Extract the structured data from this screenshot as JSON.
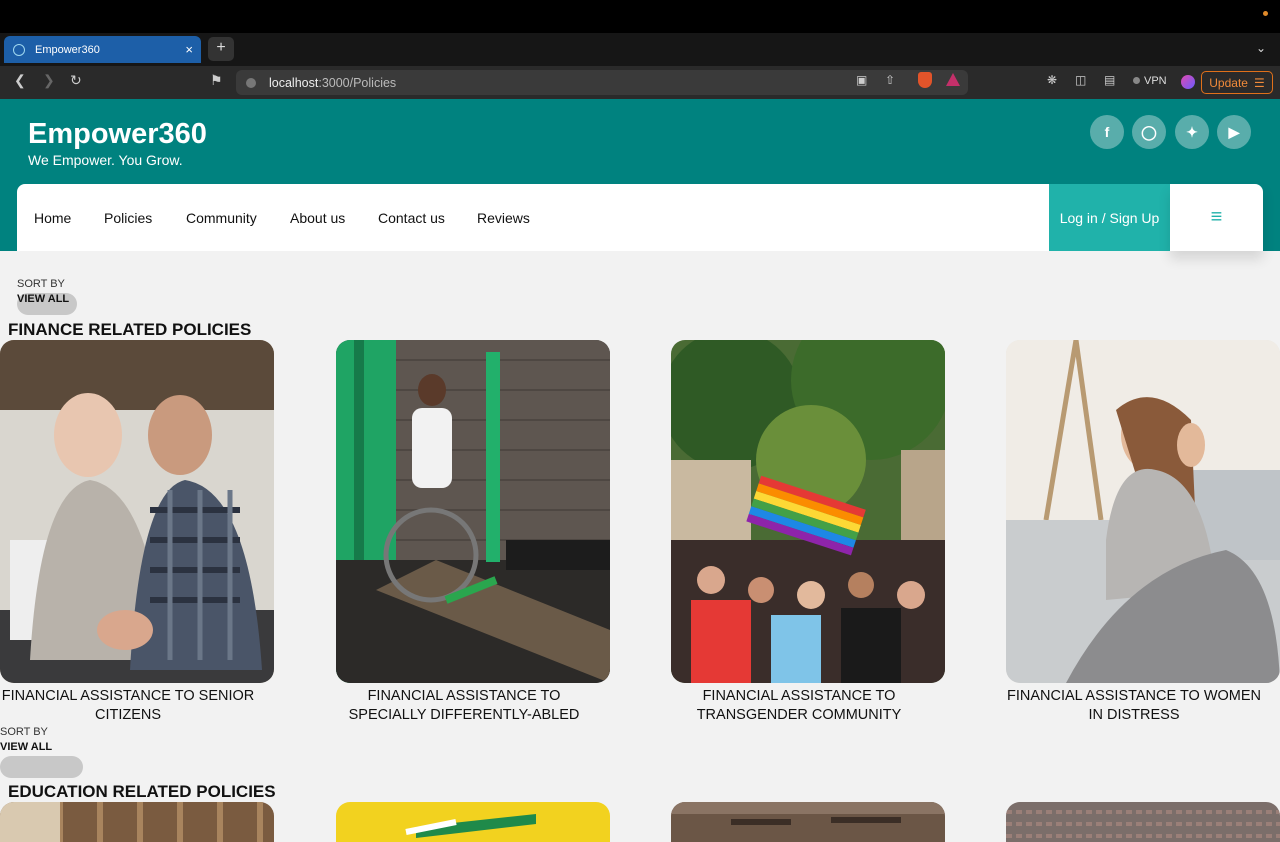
{
  "browser": {
    "tab_title": "Empower360",
    "tab_close": "×",
    "new_tab": "+",
    "tab_chevron": "⌄",
    "url_host": "localhost",
    "url_path": ":3000/Policies",
    "vpn_label": "VPN",
    "update_label": "Update"
  },
  "site": {
    "brand": "Empower360",
    "tagline": "We Empower. You Grow.",
    "social_icons": [
      "facebook-icon",
      "instagram-icon",
      "twitter-icon",
      "youtube-icon"
    ]
  },
  "nav": {
    "items": [
      "Home",
      "Policies",
      "Community",
      "About us",
      "Contact us",
      "Reviews"
    ],
    "login": "Log in / Sign Up",
    "menu_glyph": "≡"
  },
  "sections": [
    {
      "sort_by": "SORT BY",
      "view_all": "VIEW ALL",
      "title": "FINANCE RELATED POLICIES",
      "cards": [
        {
          "caption_1": "FINANCIAL ASSISTANCE TO SENIOR",
          "caption_2": "CITIZENS"
        },
        {
          "caption_1": "FINANCIAL ASSISTANCE TO",
          "caption_2": "SPECIALLY DIFFERENTLY-ABLED"
        },
        {
          "caption_1": "FINANCIAL ASSISTANCE TO",
          "caption_2": "TRANSGENDER COMMUNITY"
        },
        {
          "caption_1": "FINANCIAL ASSISTANCE TO WOMEN",
          "caption_2": "IN DISTRESS"
        }
      ]
    },
    {
      "sort_by": "SORT BY",
      "view_all": "VIEW ALL",
      "title": "EDUCATION RELATED POLICIES"
    }
  ],
  "colors": {
    "header_teal": "#00827f",
    "login_teal": "#20b2aa",
    "page_bg": "#f2f2f2"
  }
}
